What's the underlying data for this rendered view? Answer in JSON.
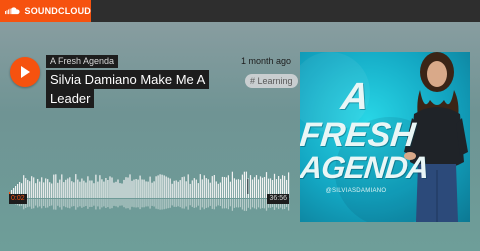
{
  "brand": {
    "name": "SOUNDCLOUD",
    "icon": "soundcloud-logo-icon"
  },
  "colors": {
    "accent": "#f6520f",
    "topbar": "#2e2e2e",
    "label_bg": "#1d1d1d"
  },
  "track": {
    "artist": "A Fresh Agenda",
    "title_line1": "Silvia Damiano Make Me A",
    "title_line2": "Leader",
    "posted": "1 month ago",
    "tag": "# Learning"
  },
  "player": {
    "current_time": "0:02",
    "duration": "36:56",
    "play_icon": "play-icon",
    "progress": 0.001
  },
  "artwork": {
    "line1": "A",
    "line2": "FRESH",
    "line3": "AGENDA",
    "handle": "@SILVIASDAMIANO"
  }
}
